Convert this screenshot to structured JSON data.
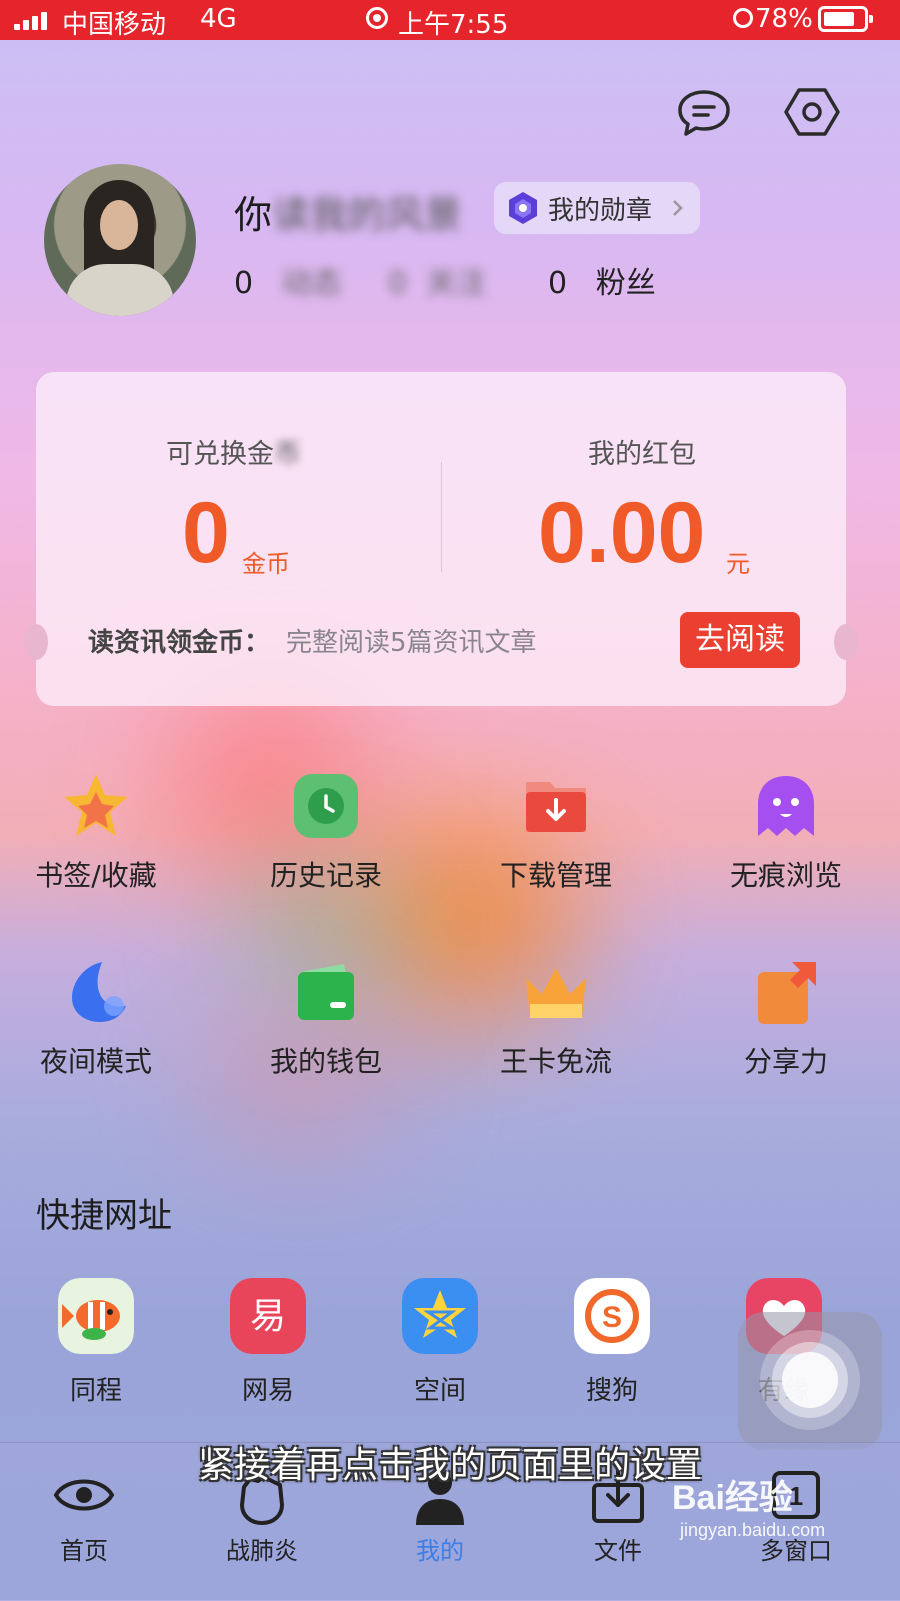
{
  "status_bar": {
    "carrier": "中国移动",
    "network": "4G",
    "time": "上午7:55",
    "battery": "78%",
    "battery_level": 0.78
  },
  "profile": {
    "name_prefix": "你",
    "name_obscured": "读我的风景",
    "medal_label": "我的勋章",
    "stats": [
      {
        "count": "0",
        "label": "动态"
      },
      {
        "count": "0",
        "label": "关注",
        "shown": "主"
      },
      {
        "count": "0",
        "label": "粉丝"
      }
    ]
  },
  "coin_card": {
    "coins_label_prefix": "可兑换金",
    "coins_label_blurred": "币",
    "coins_value": "0",
    "coins_unit": "金币",
    "red_packet_label": "我的红包",
    "red_packet_value": "0.00",
    "red_packet_unit": "元",
    "task_label": "读资讯领金币：",
    "task_desc": "完整阅读5篇资讯文章",
    "read_button": "去阅读"
  },
  "menu_grid": [
    {
      "label": "书签/收藏",
      "icon": "star-icon"
    },
    {
      "label": "历史记录",
      "icon": "clock-icon"
    },
    {
      "label": "下载管理",
      "icon": "download-folder-icon"
    },
    {
      "label": "无痕浏览",
      "icon": "ghost-icon"
    },
    {
      "label": "夜间模式",
      "icon": "moon-icon"
    },
    {
      "label": "我的钱包",
      "icon": "wallet-icon"
    },
    {
      "label": "王卡免流",
      "icon": "crown-icon"
    },
    {
      "label": "分享力",
      "icon": "share-gift-icon"
    }
  ],
  "quick_links": {
    "title": "快捷网址",
    "items": [
      {
        "label": "同程",
        "icon": "tongcheng-fish-icon",
        "color": "#e8f4e0"
      },
      {
        "label": "网易",
        "icon": "netease-icon",
        "color": "#e8455a"
      },
      {
        "label": "空间",
        "icon": "qzone-star-icon",
        "color": "#3b8ff0"
      },
      {
        "label": "搜狗",
        "icon": "sogou-icon",
        "color": "#ffffff"
      },
      {
        "label": "有缘",
        "icon": "youyuan-heart-icon",
        "color": "#e84463"
      }
    ]
  },
  "bottom_nav": [
    {
      "label": "首页",
      "icon": "eye-icon",
      "active": false
    },
    {
      "label": "战肺炎",
      "icon": "fist-icon",
      "active": false
    },
    {
      "label": "我的",
      "icon": "person-icon",
      "active": true
    },
    {
      "label": "文件",
      "icon": "file-download-icon",
      "active": false
    },
    {
      "label": "多窗口",
      "icon": "window-count-icon",
      "active": false,
      "count": "1"
    }
  ],
  "overlay": {
    "subtitle": "紧接着再点击我的页面里的设置",
    "watermark_brand": "Bai经验",
    "watermark_url": "jingyan.baidu.com"
  },
  "colors": {
    "status_bar": "#e5242c",
    "accent_orange": "#ef5a28",
    "read_button": "#ea3f31",
    "nav_active": "#3a7ee8"
  }
}
